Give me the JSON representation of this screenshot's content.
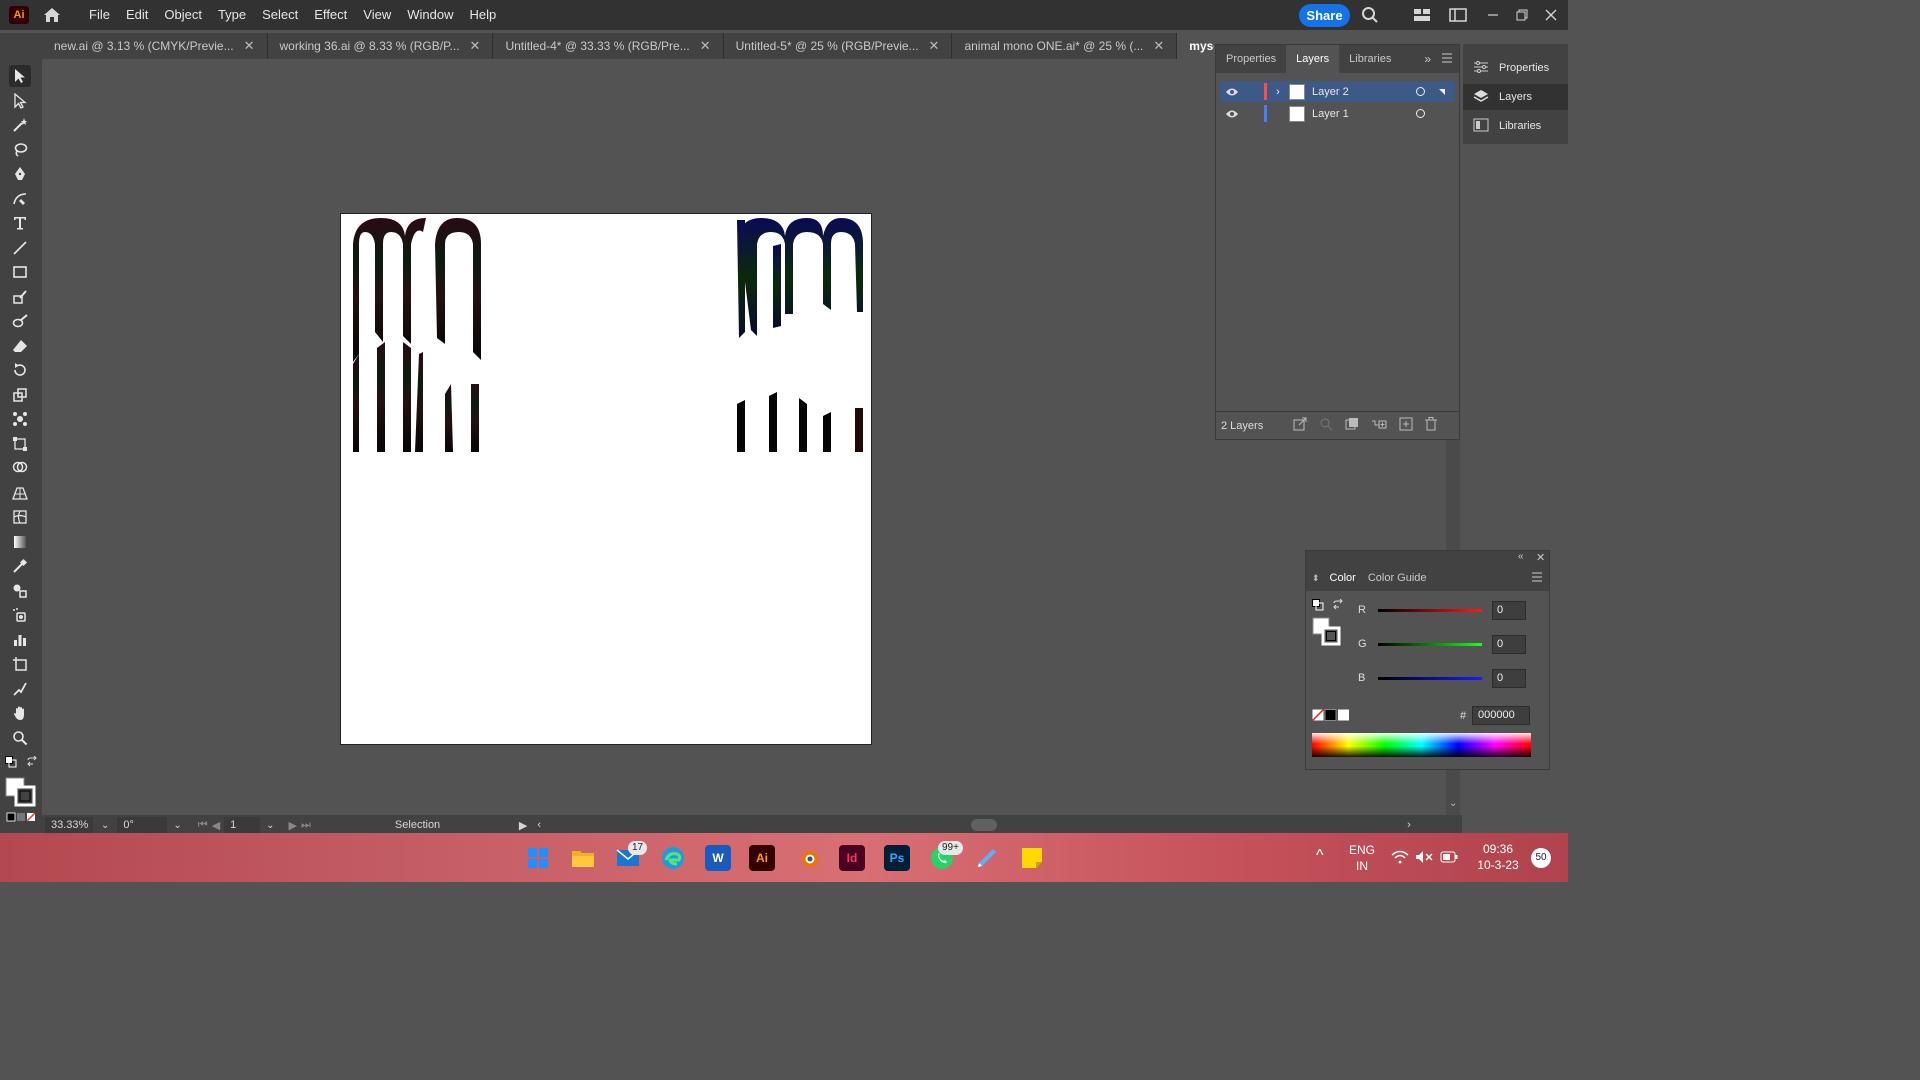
{
  "app": {
    "logo_text": "Ai"
  },
  "menu": {
    "items": [
      "File",
      "Edit",
      "Object",
      "Type",
      "Select",
      "Effect",
      "View",
      "Window",
      "Help"
    ]
  },
  "header": {
    "share_label": "Share"
  },
  "tabs": [
    {
      "label": "new.ai @ 3.13 % (CMYK/Previe...",
      "active": false
    },
    {
      "label": "working 36.ai @ 8.33 % (RGB/P...",
      "active": false
    },
    {
      "label": "Untitled-4* @ 33.33 % (RGB/Pre...",
      "active": false
    },
    {
      "label": "Untitled-5* @ 25 % (RGB/Previe...",
      "active": false
    },
    {
      "label": "animal mono ONE.ai* @ 25 % (...",
      "active": false
    },
    {
      "label": "myself.logo worki",
      "active": true
    }
  ],
  "layers_panel": {
    "tabs": [
      "Properties",
      "Layers",
      "Libraries"
    ],
    "active_tab": "Layers",
    "layers": [
      {
        "name": "Layer 2",
        "color": "#ff4d4d",
        "selected": true
      },
      {
        "name": "Layer 1",
        "color": "#4d7bff",
        "selected": false
      }
    ],
    "count_label": "2 Layers"
  },
  "right_dock": {
    "items": [
      "Properties",
      "Layers",
      "Libraries"
    ],
    "active": "Layers"
  },
  "color_panel": {
    "tabs": [
      "Color",
      "Color Guide"
    ],
    "channels": [
      {
        "label": "R",
        "value": "0",
        "gradient": "linear-gradient(90deg,#000,#ff0000)"
      },
      {
        "label": "G",
        "value": "0",
        "gradient": "linear-gradient(90deg,#000,#00ff00)"
      },
      {
        "label": "B",
        "value": "0",
        "gradient": "linear-gradient(90deg,#000,#0000ff)"
      }
    ],
    "hex_label": "#",
    "hex_value": "000000"
  },
  "statusbar": {
    "zoom": "33.33%",
    "rotation": "0°",
    "artboard": "1",
    "tool": "Selection"
  },
  "taskbar": {
    "mail_badge": "17",
    "whatsapp_badge": "99+",
    "lang": "ENG",
    "region": "IN",
    "time": "09:36",
    "date": "10-3-23",
    "notif": "50"
  }
}
